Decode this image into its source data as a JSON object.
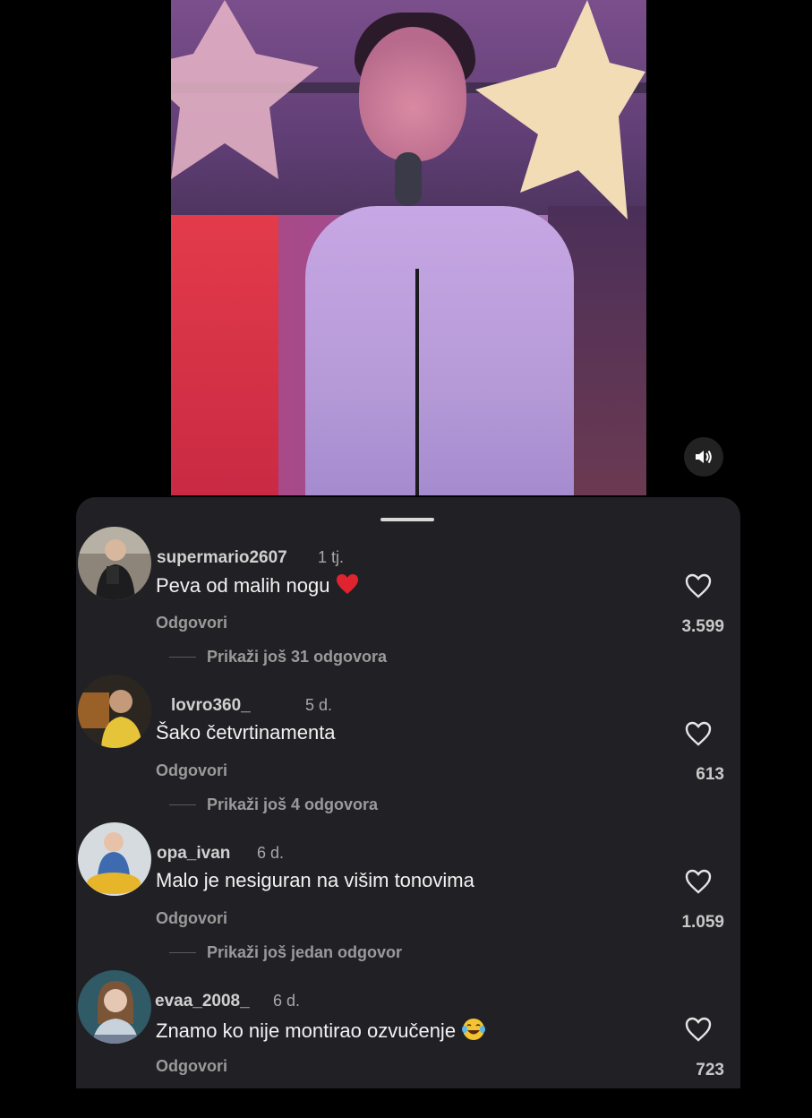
{
  "video": {
    "sound_icon": "speaker-icon"
  },
  "comments": [
    {
      "username": "supermario2607",
      "time": "1 tj.",
      "text": "Peva od malih nogu",
      "emoji": "red-heart",
      "reply_label": "Odgovori",
      "more_replies": "Prikaži još 31 odgovora",
      "likes": "3.599"
    },
    {
      "username": "lovro360_",
      "time": "5 d.",
      "text": "Šako četvrtinamenta",
      "emoji": "",
      "reply_label": "Odgovori",
      "more_replies": "Prikaži još 4 odgovora",
      "likes": "613"
    },
    {
      "username": "opa_ivan",
      "time": "6 d.",
      "text": "Malo je nesiguran na višim tonovima",
      "emoji": "",
      "reply_label": "Odgovori",
      "more_replies": "Prikaži još jedan odgovor",
      "likes": "1.059"
    },
    {
      "username": "evaa_2008_",
      "time": "6 d.",
      "text": "Znamo ko nije montirao ozvučenje ",
      "emoji": "tears-of-joy",
      "reply_label": "Odgovori",
      "more_replies": "",
      "likes": "723"
    }
  ],
  "colors": {
    "sheet_bg": "#212125",
    "page_bg": "#000000",
    "emoji_heart": "#e0242f"
  }
}
